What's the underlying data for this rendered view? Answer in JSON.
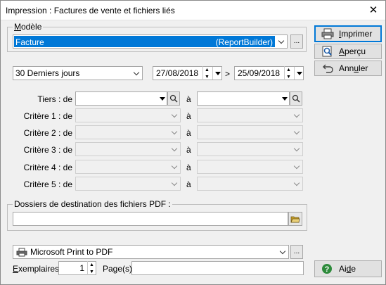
{
  "window": {
    "title": "Impression : Factures de vente et fichiers liés"
  },
  "modele": {
    "legend": "Modèle",
    "legend_hotkey": "M",
    "legend_rest": "odèle",
    "selected_name": "Facture",
    "selected_type": "(ReportBuilder)",
    "more": "..."
  },
  "buttons": {
    "print": {
      "hot": "I",
      "rest": "mprimer"
    },
    "preview": {
      "hot": "A",
      "rest": "perçu"
    },
    "cancel": {
      "pre": "Ann",
      "hot": "u",
      "rest": "ler"
    },
    "help": {
      "pre": "Ai",
      "hot": "d",
      "rest": "e"
    }
  },
  "period": {
    "selected": "30 Derniers jours",
    "from": "27/08/2018",
    "separator": ">",
    "to": "25/09/2018"
  },
  "criteria": {
    "to_label": "à",
    "rows": [
      {
        "label": "Tiers : de"
      },
      {
        "label": "Critère 1 : de"
      },
      {
        "label": "Critère 2 : de"
      },
      {
        "label": "Critère 3 : de"
      },
      {
        "label": "Critère 4 : de"
      },
      {
        "label": "Critère 5 : de"
      }
    ]
  },
  "pdf": {
    "legend": "Dossiers de destination des fichiers PDF :",
    "value": ""
  },
  "printer": {
    "selected": "Microsoft Print to PDF",
    "more": "...",
    "copies_label_hot": "E",
    "copies_label_rest": "xemplaires",
    "copies_value": "1",
    "pages_label": "Page(s)",
    "pages_value": ""
  },
  "colors": {
    "selection": "#0078d7",
    "help_icon": "#2e8b3c"
  }
}
